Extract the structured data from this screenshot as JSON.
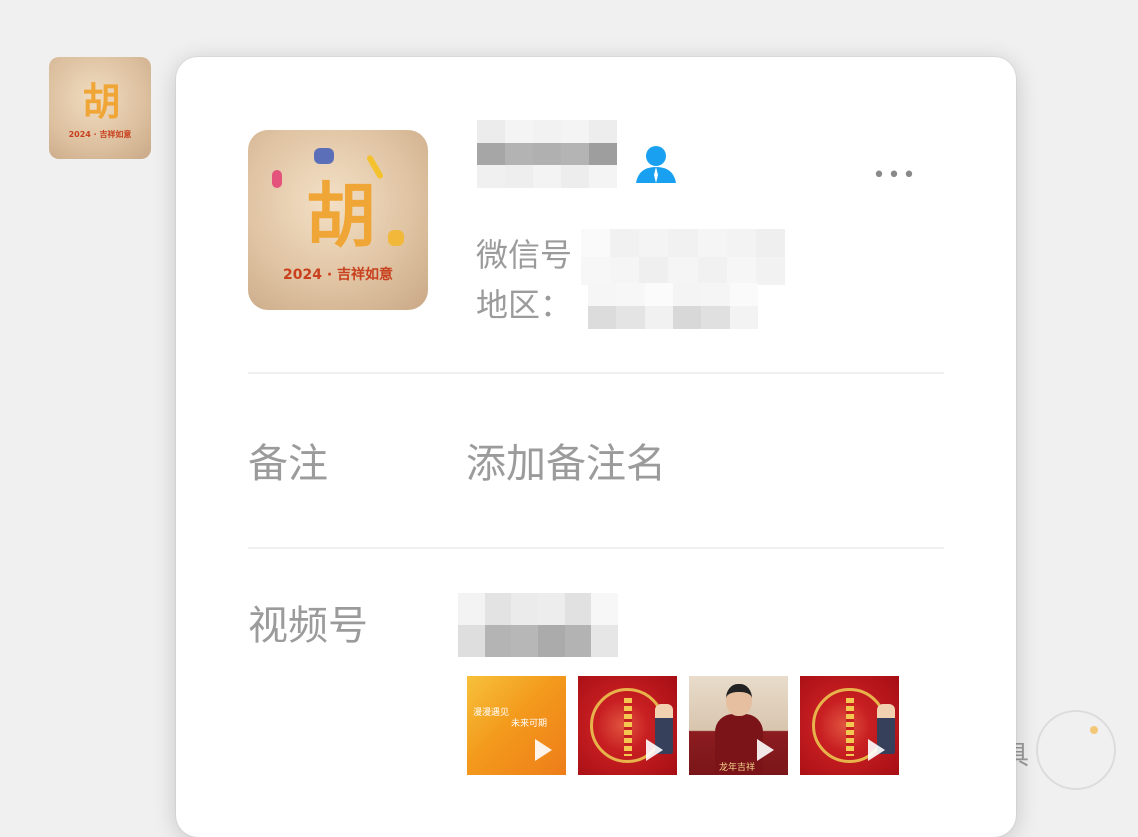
{
  "profile": {
    "wechat_id_label": "微信号",
    "region_label": "地区：",
    "more_label": "•••"
  },
  "remark": {
    "label": "备注",
    "placeholder": "添加备注名"
  },
  "channels": {
    "label": "视频号",
    "videos": [
      {
        "caption_1": "漫漫遇见",
        "caption_2": "未来可期",
        "style": "orange"
      },
      {
        "caption_1": "",
        "caption_2": "",
        "style": "red"
      },
      {
        "caption_1": "龙年吉祥",
        "caption_2": "",
        "style": "person"
      },
      {
        "caption_1": "",
        "caption_2": "",
        "style": "red"
      }
    ]
  },
  "avatar": {
    "text_big": "胡",
    "text_small": "2024 · 吉祥如意"
  },
  "watermark": {
    "glyph": "具"
  },
  "colors": {
    "person_icon": "#1aa0f0",
    "label_gray": "#9b9b9b"
  }
}
